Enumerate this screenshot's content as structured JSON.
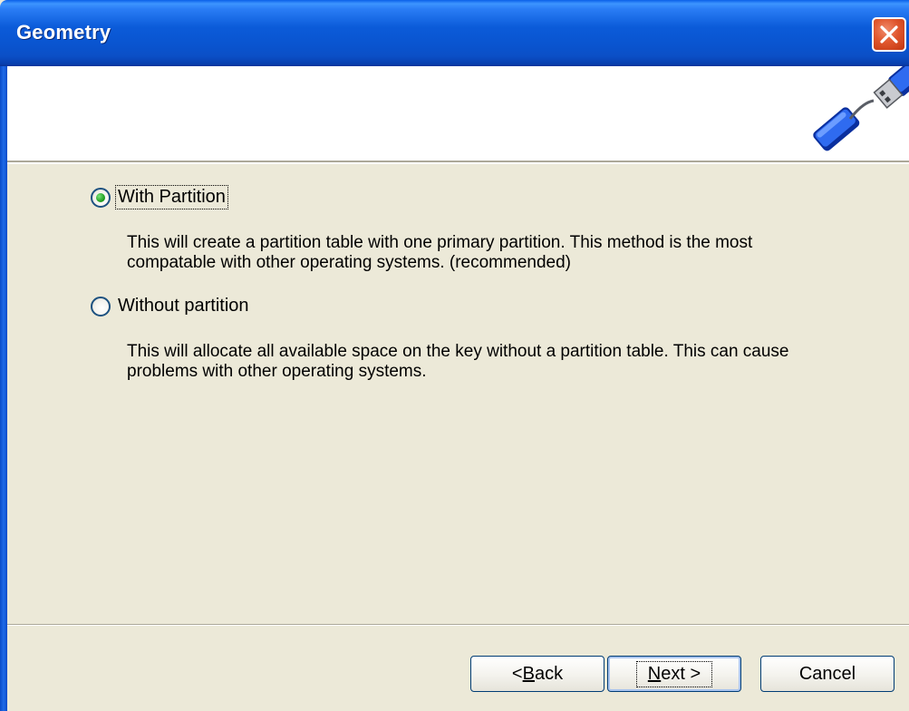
{
  "window": {
    "title": "Geometry"
  },
  "header": {
    "icon": "usb-key-icon"
  },
  "options": [
    {
      "label": "With Partition",
      "selected": true,
      "description": "This will create a partition table with one primary partition.  This method is the most compatable with other operating systems. (recommended)"
    },
    {
      "label": "Without partition",
      "selected": false,
      "description": "This will allocate all available space on the key without a partition table.  This can cause problems with other operating systems."
    }
  ],
  "buttons": {
    "back": {
      "mnemonic": "B",
      "rest": "ack",
      "prefix": "< "
    },
    "next": {
      "mnemonic": "N",
      "rest": "ext",
      "suffix": " >"
    },
    "cancel": "Cancel"
  },
  "colors": {
    "titlebar": "#0A54CF",
    "dialog_bg": "#ECE9D8",
    "close_button": "#E0572E",
    "radio_checked": "#21A121"
  }
}
